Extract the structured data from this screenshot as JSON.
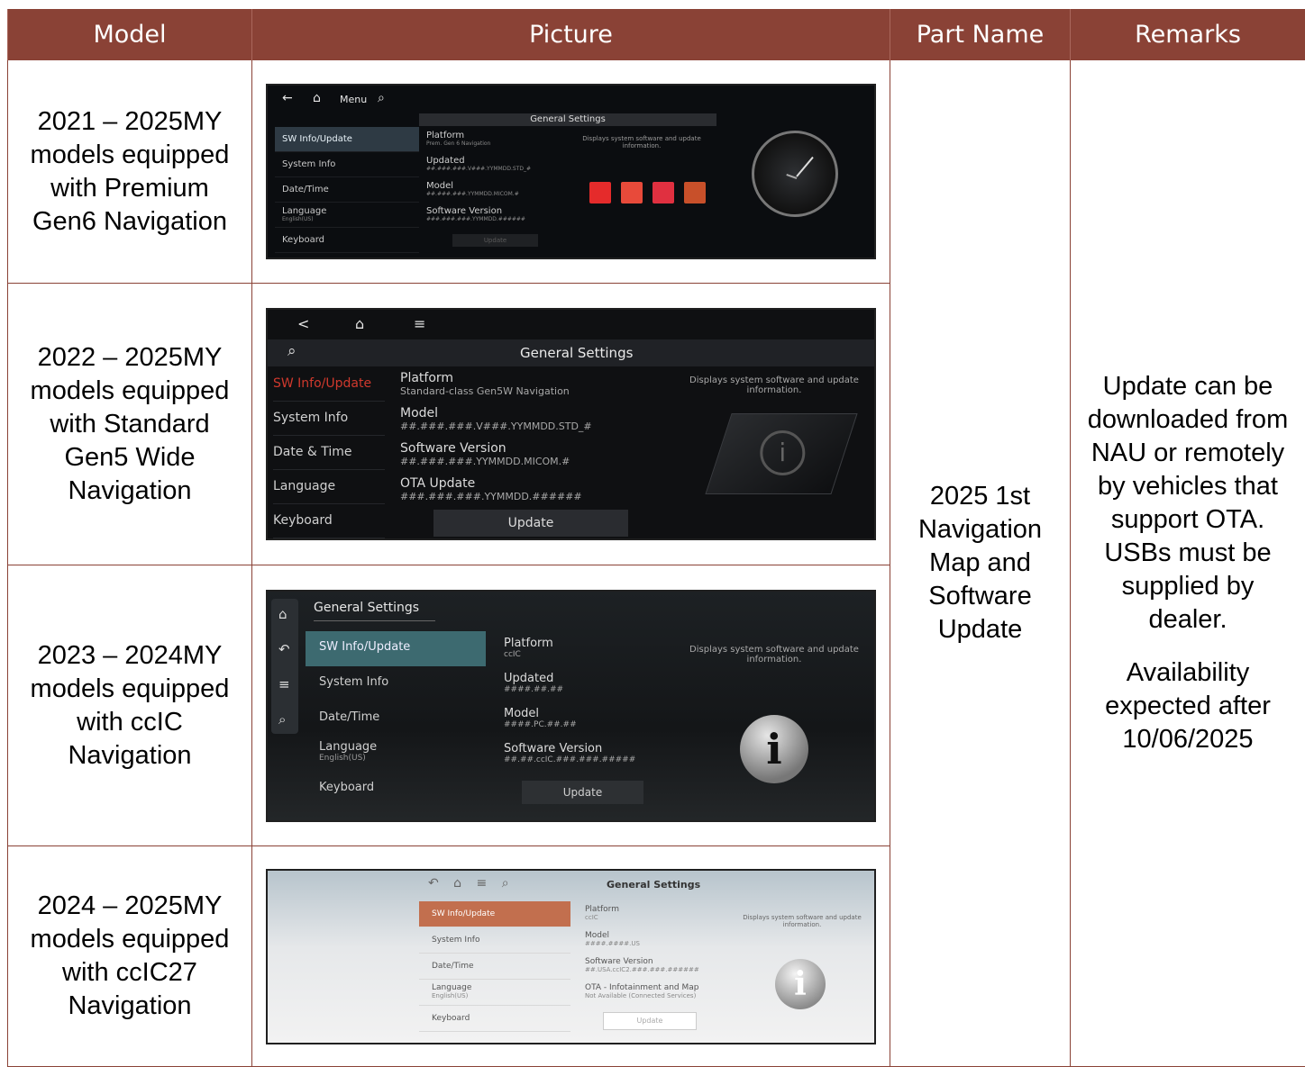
{
  "headers": {
    "model": "Model",
    "picture": "Picture",
    "part_name": "Part Name",
    "remarks": "Remarks"
  },
  "rows": [
    {
      "model": [
        "2021 – 2025MY",
        "models equipped",
        "with Premium",
        "Gen6 Navigation"
      ],
      "screen": {
        "nav": {
          "back": "←",
          "home": "⌂",
          "menu": "Menu",
          "search": "⌕"
        },
        "title": "General Settings",
        "menu": [
          {
            "label": "SW Info/Update",
            "sub": ""
          },
          {
            "label": "System Info",
            "sub": ""
          },
          {
            "label": "Date/Time",
            "sub": ""
          },
          {
            "label": "Language",
            "sub": "English(US)"
          },
          {
            "label": "Keyboard",
            "sub": ""
          }
        ],
        "list": [
          {
            "label": "Platform",
            "value": "Prem. Gen 6 Navigation"
          },
          {
            "label": "Updated",
            "value": "##.###.###.V###.YYMMDD.STD_#"
          },
          {
            "label": "Model",
            "value": "##.###.###.YYMMDD.MICOM.#"
          },
          {
            "label": "Software Version",
            "value": "###.###.###.YYMMDD.######"
          }
        ],
        "description": "Displays system software and update information.",
        "update": "Update",
        "logo_colors": [
          "#e52b2b",
          "#e84a3a",
          "#e03040",
          "#c8502a"
        ]
      }
    },
    {
      "model": [
        "2022 – 2025MY",
        "models equipped",
        "with Standard",
        "Gen5 Wide",
        "Navigation"
      ],
      "screen": {
        "nav": {
          "back": "<",
          "home": "⌂",
          "menu": "≡",
          "search": "⌕"
        },
        "title": "General Settings",
        "menu": [
          {
            "label": "SW Info/Update"
          },
          {
            "label": "System Info"
          },
          {
            "label": "Date & Time"
          },
          {
            "label": "Language"
          },
          {
            "label": "Keyboard"
          }
        ],
        "list": [
          {
            "label": "Platform",
            "value": "Standard-class Gen5W Navigation"
          },
          {
            "label": "Model",
            "value": "##.###.###.V###.YYMMDD.STD_#"
          },
          {
            "label": "Software Version",
            "value": "##.###.###.YYMMDD.MICOM.#"
          },
          {
            "label": "OTA Update",
            "value": "###.###.###.YYMMDD.######"
          }
        ],
        "description": "Displays system software and update information.",
        "update": "Update",
        "accent": "#d0392d"
      }
    },
    {
      "model": [
        "2023 – 2024MY",
        "models equipped",
        "with ccIC",
        "Navigation"
      ],
      "screen": {
        "nav": {
          "home": "⌂",
          "back": "↶",
          "menu": "≡",
          "search": "⌕"
        },
        "title": "General Settings",
        "menu": [
          {
            "label": "SW Info/Update",
            "sub": ""
          },
          {
            "label": "System Info",
            "sub": ""
          },
          {
            "label": "Date/Time",
            "sub": ""
          },
          {
            "label": "Language",
            "sub": "English(US)"
          },
          {
            "label": "Keyboard",
            "sub": ""
          }
        ],
        "list": [
          {
            "label": "Platform",
            "value": "ccIC"
          },
          {
            "label": "Updated",
            "value": "####.##.##"
          },
          {
            "label": "Model",
            "value": "####.PC.##.##"
          },
          {
            "label": "Software Version",
            "value": "##.##.ccIC.###.###.#####"
          }
        ],
        "description": "Displays system software and update information.",
        "update": "Update",
        "info_glyph": "i",
        "accent": "#3d6a70"
      }
    },
    {
      "model": [
        "2024 – 2025MY",
        "models equipped",
        "with ccIC27",
        "Navigation"
      ],
      "screen": {
        "nav_icons": "↶ ⌂ ≡ ⌕",
        "title": "General Settings",
        "menu": [
          {
            "label": "SW Info/Update",
            "sub": ""
          },
          {
            "label": "System Info",
            "sub": ""
          },
          {
            "label": "Date/Time",
            "sub": ""
          },
          {
            "label": "Language",
            "sub": "English(US)"
          },
          {
            "label": "Keyboard",
            "sub": ""
          }
        ],
        "list": [
          {
            "label": "Platform",
            "value": "ccIC"
          },
          {
            "label": "Model",
            "value": "####.####.US"
          },
          {
            "label": "Software Version",
            "value": "##.USA.ccIC2.###.###.######"
          },
          {
            "label": "OTA - Infotainment and Map",
            "value": "Not Available (Connected Services)"
          }
        ],
        "description": "Displays system software and update information.",
        "update": "Update",
        "info_glyph": "i",
        "accent": "#c26f4e"
      }
    }
  ],
  "part_name": [
    "2025 1st",
    "Navigation",
    "Map and",
    "Software",
    "Update"
  ],
  "remarks": {
    "p1": [
      "Update can be",
      "downloaded from",
      "NAU or remotely",
      "by vehicles that",
      "support OTA.",
      "USBs must be",
      "supplied by",
      "dealer."
    ],
    "p2": [
      "Availability",
      "expected after",
      "10/06/2025"
    ]
  }
}
